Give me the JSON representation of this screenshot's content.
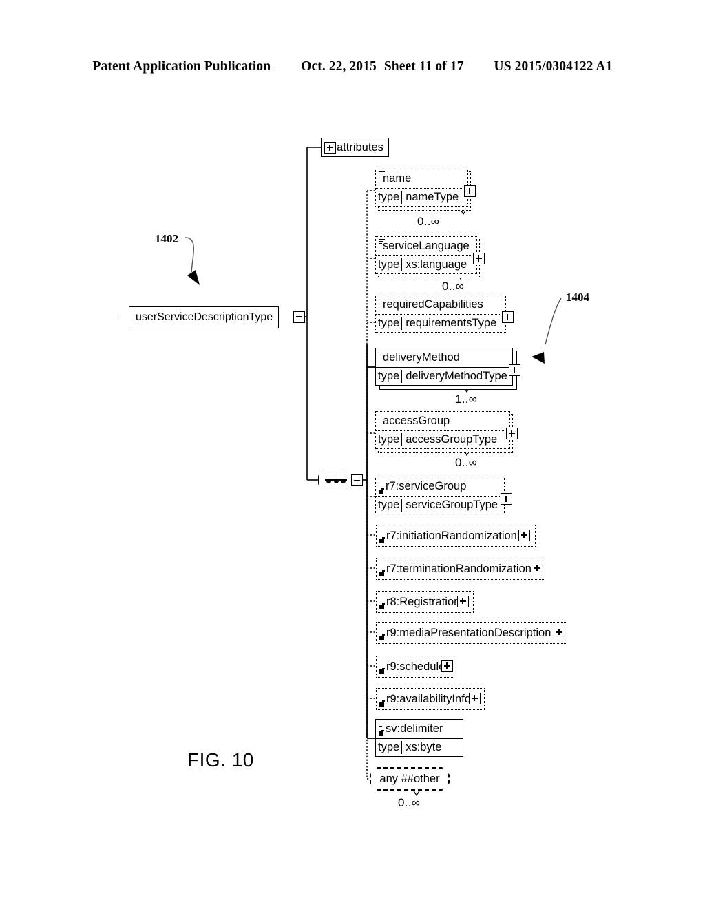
{
  "header": {
    "publication": "Patent Application Publication",
    "date": "Oct. 22, 2015",
    "sheet": "Sheet 11 of 17",
    "patent_number": "US 2015/0304122 A1"
  },
  "figure": {
    "caption": "FIG. 10",
    "reference_numerals": [
      {
        "id": "1402",
        "label": "1402"
      },
      {
        "id": "1404",
        "label": "1404"
      }
    ]
  },
  "diagram": {
    "root": {
      "label": "userServiceDescriptionType",
      "handle": "minus"
    },
    "attributes_box": {
      "label": "attributes",
      "handle": "plus"
    },
    "sequence_node": {
      "name": "sequence-compositor",
      "handle": "minus"
    },
    "type_key_label": "type",
    "elements": [
      {
        "name": "name",
        "type": "nameType",
        "cardinality": "0..∞",
        "optional": true,
        "repeating": true,
        "annotation": true,
        "reference": false,
        "handle": "plus"
      },
      {
        "name": "serviceLanguage",
        "type": "xs:language",
        "cardinality": "0..∞",
        "optional": true,
        "repeating": true,
        "annotation": true,
        "reference": false,
        "handle": "plus"
      },
      {
        "name": "requiredCapabilities",
        "type": "requirementsType",
        "cardinality": "",
        "optional": true,
        "repeating": false,
        "annotation": false,
        "reference": false,
        "handle": "plus"
      },
      {
        "name": "deliveryMethod",
        "type": "deliveryMethodType",
        "cardinality": "1..∞",
        "optional": false,
        "repeating": true,
        "annotation": false,
        "reference": false,
        "handle": "plus"
      },
      {
        "name": "accessGroup",
        "type": "accessGroupType",
        "cardinality": "0..∞",
        "optional": true,
        "repeating": true,
        "annotation": false,
        "reference": false,
        "handle": "plus"
      },
      {
        "name": "r7:serviceGroup",
        "type": "serviceGroupType",
        "cardinality": "",
        "optional": true,
        "repeating": false,
        "annotation": false,
        "reference": true,
        "handle": "plus"
      },
      {
        "name": "r7:initiationRandomization",
        "type": "",
        "cardinality": "",
        "optional": true,
        "repeating": false,
        "annotation": false,
        "reference": true,
        "handle": "plus"
      },
      {
        "name": "r7:terminationRandomization",
        "type": "",
        "cardinality": "",
        "optional": true,
        "repeating": false,
        "annotation": false,
        "reference": true,
        "handle": "plus"
      },
      {
        "name": "r8:Registration",
        "type": "",
        "cardinality": "",
        "optional": true,
        "repeating": false,
        "annotation": false,
        "reference": true,
        "handle": "plus"
      },
      {
        "name": "r9:mediaPresentationDescription",
        "type": "",
        "cardinality": "",
        "optional": true,
        "repeating": false,
        "annotation": false,
        "reference": true,
        "handle": "plus"
      },
      {
        "name": "r9:schedule",
        "type": "",
        "cardinality": "",
        "optional": true,
        "repeating": false,
        "annotation": false,
        "reference": true,
        "handle": "plus"
      },
      {
        "name": "r9:availabilityInfo",
        "type": "",
        "cardinality": "",
        "optional": true,
        "repeating": false,
        "annotation": false,
        "reference": true,
        "handle": "plus"
      },
      {
        "name": "sv:delimiter",
        "type": "xs:byte",
        "cardinality": "",
        "optional": false,
        "repeating": false,
        "annotation": true,
        "reference": true,
        "handle": "none"
      }
    ],
    "wildcard": {
      "label": "any ##other",
      "cardinality": "0..∞"
    }
  }
}
